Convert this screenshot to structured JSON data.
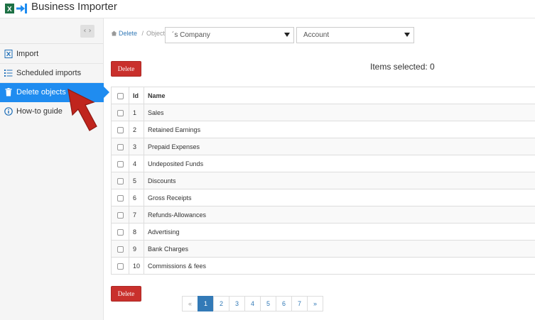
{
  "app": {
    "title": "Business Importer"
  },
  "sidebar": {
    "collapse_label": "‹ ›",
    "items": [
      {
        "label": "Import",
        "icon": "excel-file-icon",
        "active": false
      },
      {
        "label": "Scheduled imports",
        "icon": "list-icon",
        "active": false
      },
      {
        "label": "Delete objects",
        "icon": "trash-icon",
        "active": true
      },
      {
        "label": "How-to guide",
        "icon": "info-icon",
        "active": false
      }
    ]
  },
  "breadcrumb": {
    "link": "Delete",
    "separator": "/",
    "current": "Object"
  },
  "filters": {
    "company": "´s Company",
    "object_type": "Account"
  },
  "actions": {
    "delete_label": "Delete"
  },
  "status": {
    "items_selected": "Items selected: 0"
  },
  "table": {
    "headers": {
      "id": "Id",
      "name": "Name"
    },
    "rows": [
      {
        "id": "1",
        "name": "Sales"
      },
      {
        "id": "2",
        "name": "Retained Earnings"
      },
      {
        "id": "3",
        "name": "Prepaid Expenses"
      },
      {
        "id": "4",
        "name": "Undeposited Funds"
      },
      {
        "id": "5",
        "name": "Discounts"
      },
      {
        "id": "6",
        "name": "Gross Receipts"
      },
      {
        "id": "7",
        "name": "Refunds-Allowances"
      },
      {
        "id": "8",
        "name": "Advertising"
      },
      {
        "id": "9",
        "name": "Bank Charges"
      },
      {
        "id": "10",
        "name": "Commissions & fees"
      }
    ]
  },
  "pagination": {
    "prev": "«",
    "pages": [
      "1",
      "2",
      "3",
      "4",
      "5",
      "6",
      "7"
    ],
    "active": "1",
    "next": "»"
  },
  "colors": {
    "accent": "#1f8cf0",
    "danger": "#c9302c",
    "link": "#337ab7",
    "arrow": "#c0251d"
  }
}
